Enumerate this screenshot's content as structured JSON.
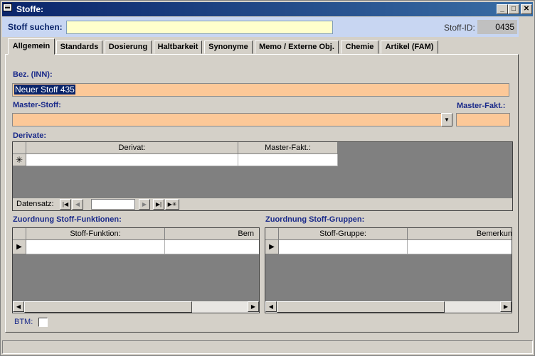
{
  "window": {
    "title": "Stoffe:",
    "min": "_",
    "max": "□",
    "close": "✕"
  },
  "search": {
    "label": "Stoff suchen:",
    "value": "",
    "id_label": "Stoff-ID:",
    "id_value": "0435"
  },
  "tabs": [
    "Allgemein",
    "Standards",
    "Dosierung",
    "Haltbarkeit",
    "Synonyme",
    "Memo / Externe Obj.",
    "Chemie",
    "Artikel (FAM)"
  ],
  "form": {
    "bez_label": "Bez. (INN):",
    "bez_value": "Neuer Stoff 435",
    "master_label": "Master-Stoff:",
    "master_value": "",
    "master_fakt_label": "Master-Fakt.:",
    "master_fakt_value": "",
    "derivate_label": "Derivate:",
    "derivate_cols": [
      "Derivat:",
      "Master-Fakt.:"
    ],
    "new_record_marker": "✳",
    "nav_label": "Datensatz:",
    "nav_value": "",
    "funktionen_label": "Zuordnung Stoff-Funktionen:",
    "funktionen_cols": [
      "Stoff-Funktion:",
      "Bem"
    ],
    "gruppen_label": "Zuordnung Stoff-Gruppen:",
    "gruppen_cols": [
      "Stoff-Gruppe:",
      "Bemerkun"
    ],
    "btm_label": "BTM:",
    "btm_checked": false
  },
  "icons": {
    "dropdown": "▼",
    "row_pointer": "▶",
    "scroll_left": "◀",
    "scroll_right": "▶",
    "nav_first": "|◀",
    "nav_prev": "◀",
    "nav_next": "▶",
    "nav_last": "▶|",
    "nav_new": "▶✳"
  }
}
